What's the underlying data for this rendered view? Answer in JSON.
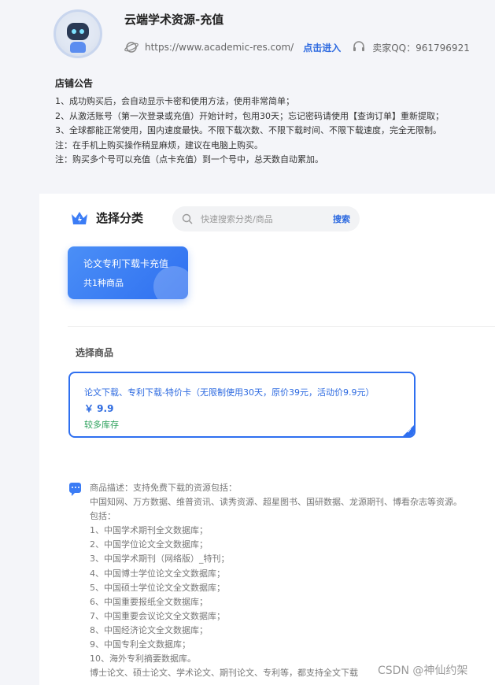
{
  "shop": {
    "title": "云端学术资源-充值",
    "url": "https://www.academic-res.com/",
    "enter_link": "点击进入",
    "qq": "卖家QQ：961796921"
  },
  "notice": {
    "title": "店铺公告",
    "lines": [
      "1、成功购买后，会自动显示卡密和使用方法，使用非常简单；",
      "2、从激活账号（第一次登录或充值）开始计时，包用30天；忘记密码请使用【查询订单】重新提取；",
      "3、全球都能正常使用，国内速度最快。不限下载次数、不限下载时间、不限下载速度，完全无限制。",
      "注：在手机上购买操作稍显麻烦，建议在电脑上购买。",
      "注：购买多个号可以充值（点卡充值）到一个号中，总天数自动累加。"
    ]
  },
  "category": {
    "title": "选择分类",
    "search_placeholder": "快速搜索分类/商品",
    "search_button": "搜索",
    "tiles": [
      {
        "name": "论文专利下载卡充值",
        "count": "共1种商品"
      }
    ]
  },
  "products": {
    "title": "选择商品",
    "items": [
      {
        "name": "论文下载、专利下载-特价卡（无限制使用30天，原价39元，活动价9.9元）",
        "price": "￥ 9.9",
        "stock": "较多库存"
      }
    ]
  },
  "description": {
    "lines": [
      "商品描述：支持免费下载的资源包括：",
      "中国知网、万方数据、维普资讯、读秀资源、超星图书、国研数据、龙源期刊、博看杂志等资源。",
      "包括：",
      "1、中国学术期刊全文数据库；",
      "2、中国学位论文全文数据库；",
      "3、中国学术期刊（网络版）_特刊；",
      "4、中国博士学位论文全文数据库；",
      "5、中国硕士学位论文全文数据库；",
      "6、中国重要报纸全文数据库；",
      "7、中国重要会议论文全文数据库；",
      "8、中国经济论文全文数据库；",
      "9、中国专利全文数据库；",
      "10、海外专利摘要数据库。",
      "博士论文、硕士论文、学术论文、期刊论文、专利等，都支持全文下载"
    ]
  },
  "watermark": "CSDN @神仙约架",
  "colors": {
    "accent": "#2e6ff0",
    "stock": "#2aa05a",
    "background": "#f4f5f9"
  }
}
